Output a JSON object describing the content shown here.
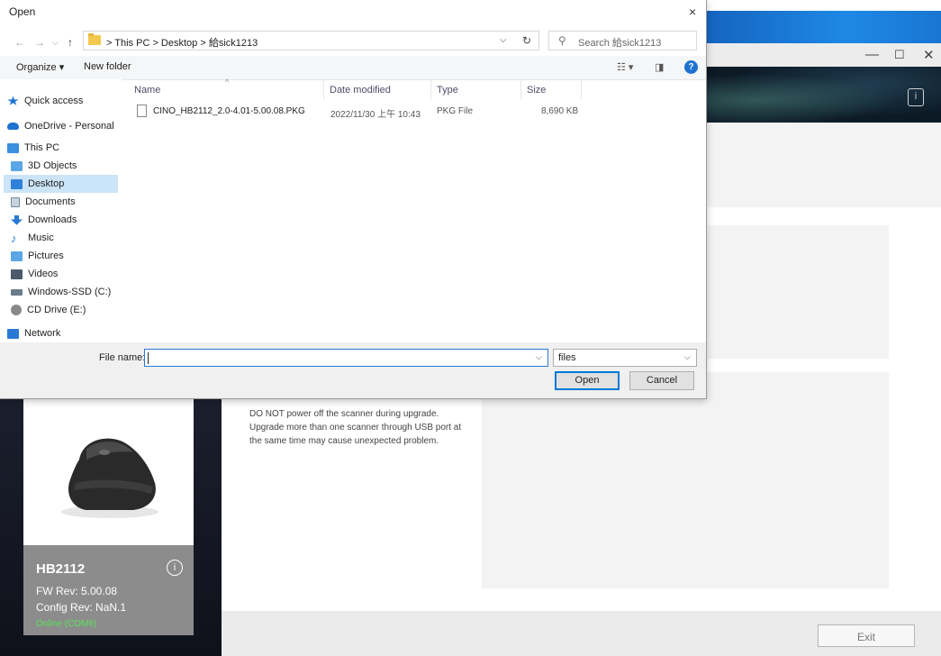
{
  "dialog": {
    "title": "Open",
    "close_glyph": "×",
    "address": {
      "path": "> This PC  >  Desktop  >  給sick1213",
      "dropdown_glyph": "⌵",
      "refresh_glyph": "↻"
    },
    "search": {
      "placeholder": "Search 給sick1213",
      "icon": "search-icon"
    },
    "toolbar": {
      "organize": "Organize ▾",
      "new_folder": "New folder",
      "help": "?"
    },
    "nav": [
      {
        "label": "Quick access",
        "icon": "star-icon",
        "color": "#1e72cf"
      },
      {
        "label": "OneDrive - Personal",
        "icon": "cloud-icon",
        "color": "#1e72cf"
      },
      {
        "label": "This PC",
        "icon": "computer-icon",
        "color": "#3d8fe0"
      },
      {
        "label": "3D Objects",
        "icon": "cube-icon",
        "color": "#5aa6e6"
      },
      {
        "label": "Desktop",
        "icon": "desktop-icon",
        "color": "#2f80d8",
        "selected": true
      },
      {
        "label": "Documents",
        "icon": "document-icon",
        "color": "#7a8a9a"
      },
      {
        "label": "Downloads",
        "icon": "download-icon",
        "color": "#2a7ad4"
      },
      {
        "label": "Music",
        "icon": "music-icon",
        "color": "#2a7ad4"
      },
      {
        "label": "Pictures",
        "icon": "picture-icon",
        "color": "#5aa6e6"
      },
      {
        "label": "Videos",
        "icon": "video-icon",
        "color": "#4a5a6a"
      },
      {
        "label": "Windows-SSD (C:)",
        "icon": "drive-icon",
        "color": "#6b7b8b"
      },
      {
        "label": "CD Drive (E:)",
        "icon": "cd-icon",
        "color": "#8a8a8a"
      },
      {
        "label": "Network",
        "icon": "network-icon",
        "color": "#2a7ad4"
      }
    ],
    "columns": [
      "Name",
      "Date modified",
      "Type",
      "Size"
    ],
    "files": [
      {
        "name": "CINO_HB2112_2.0-4.01-5.00.08.PKG",
        "date": "2022/11/30 上午 10:43",
        "type": "PKG File",
        "size": "8,690 KB"
      }
    ],
    "file_name_label": "File name:",
    "file_name_value": "",
    "file_type": "files",
    "open_button": "Open",
    "cancel_button": "Cancel"
  },
  "app": {
    "device_model": "HB2112",
    "fw_rev": "FW Rev: 5.00.08",
    "config_rev": "Config Rev: NaN.1",
    "status": "Online (COM6)",
    "warning_lines": [
      "DO NOT power off the scanner during upgrade.",
      "Upgrade more than one scanner through USB port at",
      "the same time may cause unexpected problem."
    ],
    "exit_button": "Exit",
    "window_controls": [
      "—",
      "☐",
      "✕"
    ]
  }
}
